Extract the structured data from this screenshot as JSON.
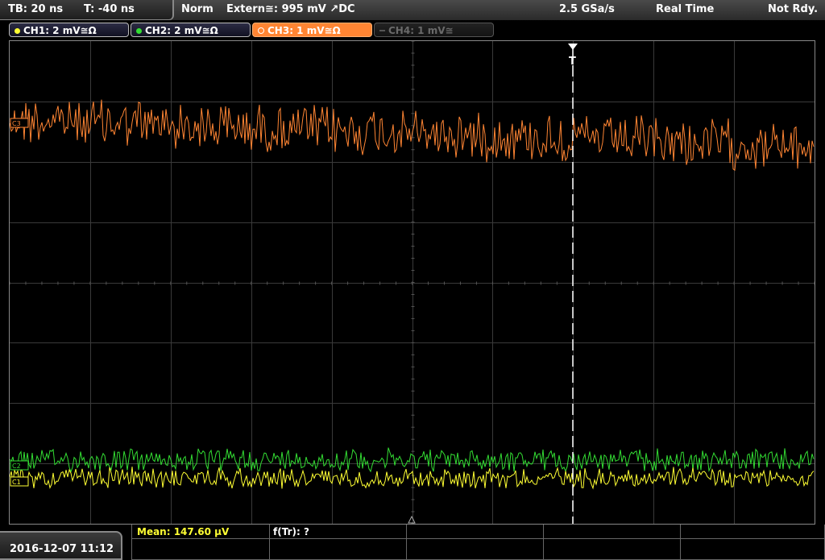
{
  "topbar": {
    "timebase": "TB: 20 ns",
    "trigger_offset": "T: -40 ns",
    "trigger_mode": "Norm",
    "trigger_source": "Extern≅: 995 mV ↗DC",
    "sample_rate": "2.5 GSa/s",
    "acq_mode": "Real Time",
    "status": "Not Rdy."
  },
  "channels": [
    {
      "label": "CH1: 2 mV≅Ω",
      "color": "#ffff33",
      "state": "on"
    },
    {
      "label": "CH2: 2 mV≅Ω",
      "color": "#33dd33",
      "state": "on"
    },
    {
      "label": "CH3: 1 mV≅Ω",
      "color": "#ff8533",
      "state": "active"
    },
    {
      "label": "CH4: 1 mV≅",
      "color": "#666666",
      "state": "off"
    }
  ],
  "screen": {
    "trigger_marker": "T",
    "ch3_marker": "C3",
    "ch2_marker": "C2",
    "ch1_marker": "C1"
  },
  "bottom": {
    "datetime": "2016-12-07 11:12",
    "meas_mean": "Mean: 147.60 μV",
    "meas_freq": "f(Tr): ?"
  },
  "colors": {
    "ch1": "#ffff33",
    "ch2": "#33dd33",
    "ch3": "#ff8533",
    "grid": "#3a3a3a"
  }
}
